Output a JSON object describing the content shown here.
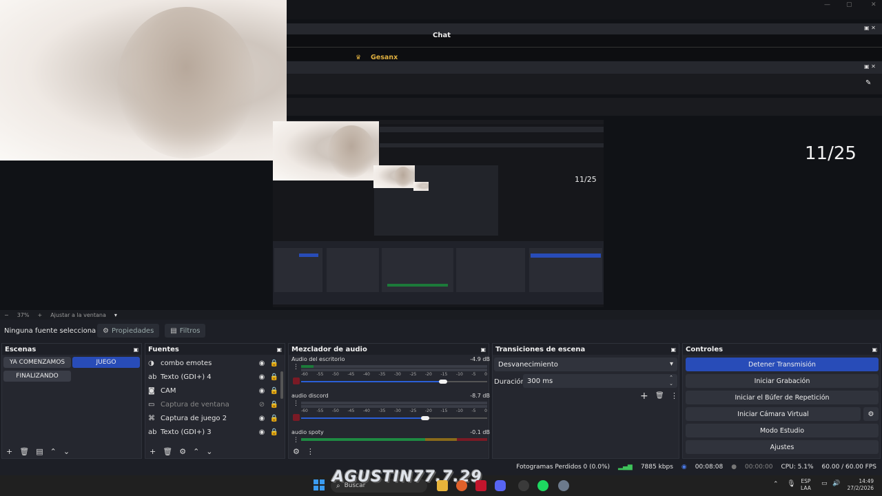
{
  "preview": {
    "chat_title": "Chat",
    "chat_user": "Gesanx",
    "counter": "11/25",
    "inner_counter": "11/25"
  },
  "zoom": {
    "minus": "−",
    "level": "37%",
    "plus": "+",
    "fit": "Ajustar a la ventana"
  },
  "info": {
    "no_source": "Ninguna fuente selecciona",
    "properties": "Propiedades",
    "filters": "Filtros"
  },
  "scenes": {
    "title": "Escenas",
    "items": [
      "YA COMENZAMOS",
      "JUEGO",
      "FINALIZANDO"
    ],
    "active": "JUEGO"
  },
  "sources": {
    "title": "Fuentes",
    "items": [
      {
        "icon": "emote-icon",
        "name": "combo emotes",
        "visible": true
      },
      {
        "icon": "text-icon",
        "name": "Texto (GDI+) 4",
        "visible": true
      },
      {
        "icon": "camera-icon",
        "name": "CAM",
        "visible": true
      },
      {
        "icon": "window-icon",
        "name": "Captura de ventana",
        "visible": false
      },
      {
        "icon": "gamepad-icon",
        "name": "Captura de juego 2",
        "visible": true
      },
      {
        "icon": "text-icon",
        "name": "Texto (GDI+) 3",
        "visible": true
      }
    ]
  },
  "mixer": {
    "title": "Mezclador de audio",
    "channels": [
      {
        "name": "Audio del escritorio",
        "db": "-4.9 dB",
        "fader": 0.84
      },
      {
        "name": "audio discord",
        "db": "-8.7 dB",
        "fader": 0.72
      },
      {
        "name": "audio spoty",
        "db": "-0.1 dB",
        "fader": 1.0
      }
    ],
    "ticks": [
      "-60",
      "-55",
      "-50",
      "-45",
      "-40",
      "-35",
      "-30",
      "-25",
      "-20",
      "-15",
      "-10",
      "-5",
      "0"
    ]
  },
  "transitions": {
    "title": "Transiciones de escena",
    "selected": "Desvanecimiento",
    "duration_label": "Duración",
    "duration_value": "300 ms"
  },
  "controls": {
    "title": "Controles",
    "buttons": [
      "Detener Transmisión",
      "Iniciar Grabación",
      "Iniciar el Búfer de Repetición",
      "Iniciar Cámara Virtual",
      "Modo Estudio",
      "Ajustes"
    ]
  },
  "status": {
    "dropped": "Fotogramas Perdidos 0 (0.0%)",
    "kbps": "7885 kbps",
    "stream_time": "00:08:08",
    "rec_time": "00:00:00",
    "cpu": "CPU: 5.1%",
    "fps": "60.00 / 60.00 FPS"
  },
  "taskbar": {
    "search": "Buscar",
    "overlay": "AGUSTIN77.7.29",
    "lang1": "ESP",
    "lang2": "LAA",
    "time": "14:49",
    "date": "27/2/2026"
  },
  "colors": {
    "accent": "#284cb8",
    "meter_green": "#1c7a3a",
    "panel": "#25272f"
  }
}
